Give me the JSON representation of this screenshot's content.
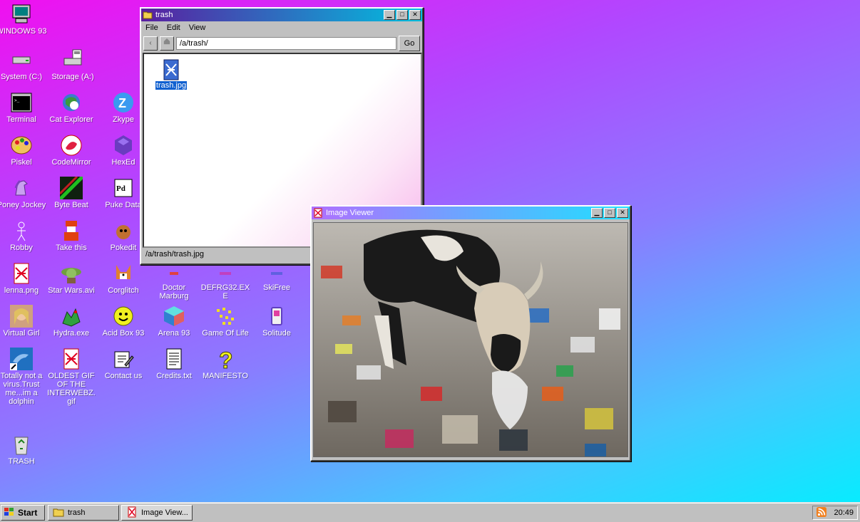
{
  "desktop": {
    "icons": [
      {
        "label": "WINDOWS 93",
        "icon": "computer-icon"
      },
      {
        "label": "System (C:)",
        "icon": "drive-icon"
      },
      {
        "label": "Storage (A:)",
        "icon": "floppy-drive-icon"
      },
      {
        "label": "Terminal",
        "icon": "terminal-icon"
      },
      {
        "label": "Cat Explorer",
        "icon": "cat-explorer-icon"
      },
      {
        "label": "Zkype",
        "icon": "zkype-icon"
      },
      {
        "label": "Piskel",
        "icon": "palette-icon"
      },
      {
        "label": "CodeMirror",
        "icon": "codemirror-icon"
      },
      {
        "label": "HexEd",
        "icon": "hexagon-icon"
      },
      {
        "label": "Poney Jockey",
        "icon": "pony-icon"
      },
      {
        "label": "Byte Beat",
        "icon": "bytebeat-icon"
      },
      {
        "label": "Puke Data",
        "icon": "pukedata-icon"
      },
      {
        "label": "Robby",
        "icon": "stickman-icon"
      },
      {
        "label": "Take this",
        "icon": "takethis-icon"
      },
      {
        "label": "Pokedit",
        "icon": "pokedit-icon"
      },
      {
        "label": "lenna.png",
        "icon": "image-file-icon"
      },
      {
        "label": "Star Wars.avi",
        "icon": "yoda-icon"
      },
      {
        "label": "Corglitch",
        "icon": "corgi-icon"
      },
      {
        "label": "Doctor Marburg",
        "icon": "doctor-icon"
      },
      {
        "label": "DEFRG32.EXE",
        "icon": "defrag-icon"
      },
      {
        "label": "SkiFree",
        "icon": "skifree-icon"
      },
      {
        "label": "Virtual Girl",
        "icon": "virtual-girl-icon"
      },
      {
        "label": "Hydra.exe",
        "icon": "hydra-icon"
      },
      {
        "label": "Acid Box 93",
        "icon": "smiley-icon"
      },
      {
        "label": "Arena 93",
        "icon": "cube-icon"
      },
      {
        "label": "Game Of Life",
        "icon": "game-of-life-icon"
      },
      {
        "label": "Solitude",
        "icon": "solitude-icon"
      },
      {
        "label": "Totally not a virus.Trust me...im a dolphin",
        "icon": "dolphin-icon"
      },
      {
        "label": "OLDEST GIF OF THE INTERWEBZ.gif",
        "icon": "gif-file-icon"
      },
      {
        "label": "Contact us",
        "icon": "contact-icon"
      },
      {
        "label": "Credits.txt",
        "icon": "text-file-icon"
      },
      {
        "label": "MANIFESTO",
        "icon": "question-icon"
      },
      {
        "label": "TRASH",
        "icon": "recycle-bin-icon"
      }
    ]
  },
  "explorer": {
    "title": "trash",
    "menu": [
      "File",
      "Edit",
      "View"
    ],
    "address": "/a/trash/",
    "go_label": "Go",
    "file": {
      "name": "trash.jpg",
      "icon": "image-file-icon"
    },
    "status": "/a/trash/trash.jpg",
    "title_gradient": [
      "#5a1fa0",
      "#00c0e0"
    ]
  },
  "viewer": {
    "title": "Image Viewer",
    "image_alt": "cow eating trash",
    "title_gradient": [
      "#b070ff",
      "#20e0ff"
    ]
  },
  "taskbar": {
    "start_label": "Start",
    "tasks": [
      {
        "label": "trash",
        "icon": "folder-icon"
      },
      {
        "label": "Image View...",
        "icon": "image-file-icon"
      }
    ],
    "clock": "20:49"
  }
}
